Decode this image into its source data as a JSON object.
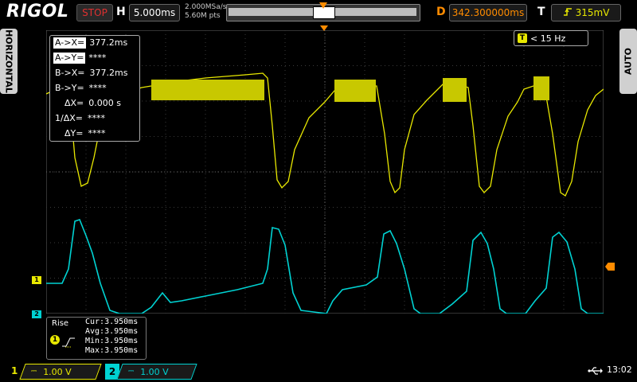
{
  "brand": "RIGOL",
  "top_bar": {
    "run_status": "STOP",
    "h_label": "H",
    "timebase": "5.000ms",
    "sample_rate": "2.000MSa/s",
    "memory_depth": "5.60M pts",
    "d_label": "D",
    "delay": "342.300000ms",
    "t_label": "T",
    "trigger_level": "315mV",
    "trigger_icon": "rising-edge-icon"
  },
  "side_left": {
    "label": "HORIZONTAL"
  },
  "side_right": {
    "label": "AUTO"
  },
  "cursor_panel": {
    "rows": [
      {
        "key": "A->X=",
        "value": "377.2ms",
        "selected": true
      },
      {
        "key": "A->Y=",
        "value": "****",
        "selected": true
      },
      {
        "key": "B->X=",
        "value": "377.2ms",
        "selected": false
      },
      {
        "key": "B->Y=",
        "value": "****",
        "selected": false
      },
      {
        "key": "ΔX=",
        "value": "0.000 s",
        "selected": false
      },
      {
        "key": "1/ΔX=",
        "value": "****",
        "selected": false
      },
      {
        "key": "ΔY=",
        "value": "****",
        "selected": false
      }
    ]
  },
  "frequency_counter": {
    "icon": "T",
    "value": "< 15 Hz"
  },
  "channel_markers": {
    "ch1": "1",
    "ch2": "2"
  },
  "measurement": {
    "title": "Rise",
    "channel": "1",
    "cur": "Cur:3.950ms",
    "avg": "Avg:3.950ms",
    "min": "Min:3.950ms",
    "max": "Max:3.950ms"
  },
  "bottom_bar": {
    "ch1": {
      "number": "1",
      "coupling": "⎓",
      "scale": "1.00 V"
    },
    "ch2": {
      "number": "2",
      "coupling": "⎓",
      "scale": "1.00 V"
    },
    "time": "13:02"
  },
  "colors": {
    "ch1": "#e8e800",
    "ch2": "#00d2d2",
    "accent": "#ff8c00",
    "stop": "#e03030"
  }
}
